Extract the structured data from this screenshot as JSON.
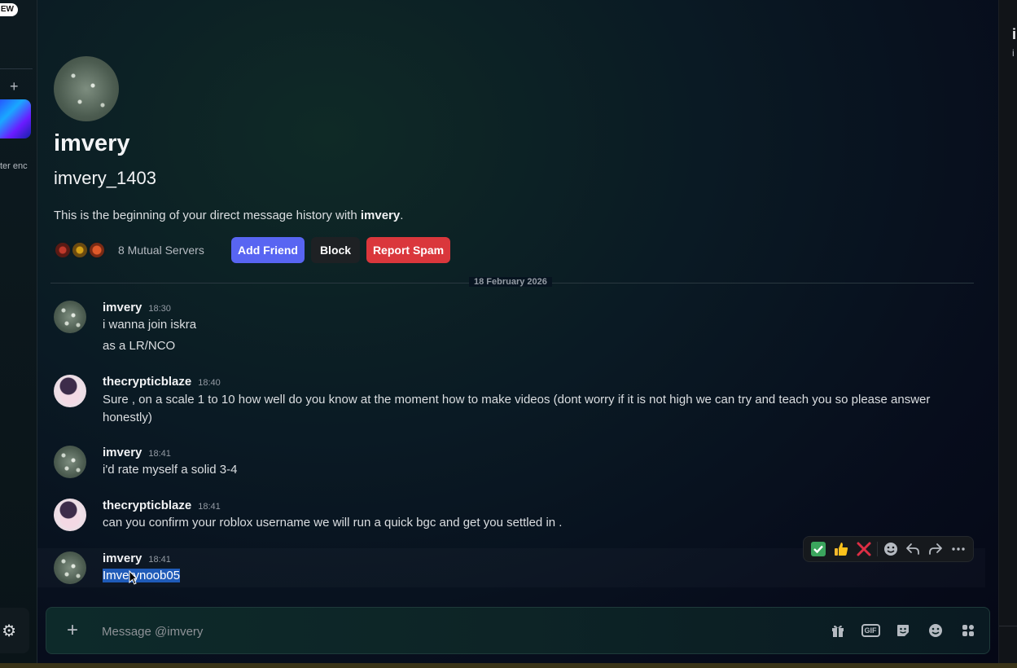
{
  "left_strip": {
    "badge": "EW",
    "server_label": "ter enc"
  },
  "profile": {
    "display_name": "imvery",
    "username": "imvery_1403",
    "intro_prefix": "This is the beginning of your direct message history with ",
    "intro_name": "imvery",
    "intro_suffix": ".",
    "mutual_servers": "8 Mutual Servers",
    "add_friend": "Add Friend",
    "block": "Block",
    "report_spam": "Report Spam"
  },
  "date_divider": "18 February 2026",
  "messages": [
    {
      "author": "imvery",
      "time": "18:30",
      "lines": [
        "i wanna join iskra",
        "as a LR/NCO"
      ]
    },
    {
      "author": "thecrypticblaze",
      "time": "18:40",
      "lines": [
        "Sure , on a scale 1 to 10 how well do you know at the moment how to make videos (dont worry if it is not high we can try and teach you so please answer honestly)"
      ]
    },
    {
      "author": "imvery",
      "time": "18:41",
      "lines": [
        "i'd rate myself a solid 3-4"
      ]
    },
    {
      "author": "thecrypticblaze",
      "time": "18:41",
      "lines": [
        "can you confirm your roblox username we will run a quick bgc and get you settled in ."
      ]
    },
    {
      "author": "imvery",
      "time": "18:41",
      "lines": [
        "Imverynoob05"
      ]
    }
  ],
  "toolbar": {
    "icons": [
      "check-reaction",
      "thumbs-up-reaction",
      "cross-reaction",
      "add-reaction",
      "reply",
      "forward",
      "more"
    ]
  },
  "composer": {
    "placeholder": "Message @imvery"
  },
  "right_panel": {
    "name": "i",
    "sub": "i"
  },
  "colors": {
    "accent": "#5865f2",
    "danger": "#da373c",
    "selection": "#1f5bb8"
  }
}
